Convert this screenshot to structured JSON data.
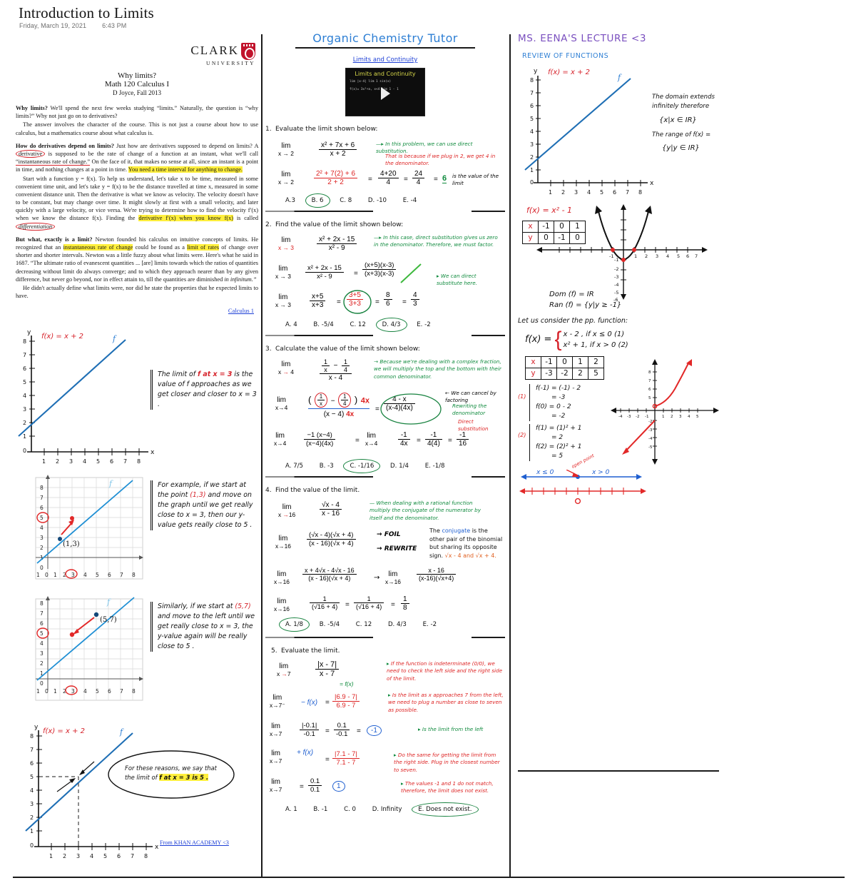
{
  "header": {
    "title": "Introduction to Limits",
    "date": "Friday, March 19, 2021",
    "time": "6:43 PM"
  },
  "left_column": {
    "logo": {
      "word": "CLARK",
      "sub": "UNIVERSITY"
    },
    "paper": {
      "title": "Why limits?",
      "course": "Math 120 Calculus I",
      "author": "D Joyce, Fall 2013",
      "p1_head": "Why limits?",
      "p1": "We'll spend the next few weeks studying “limits.” Naturally, the question is “why limits?” Why not just go on to derivatives?",
      "p2": "The answer involves the character of the course. This is not just a course about how to use calculus, but a mathematics course about what calculus is.",
      "p3_head": "How do derivatives depend on limits?",
      "p3_a": "Just how are derivatives supposed to depend on limits? A",
      "p3_circ": "derivative",
      "p3_b": "is supposed to be the rate of change of a function at an instant, what we'll call",
      "p3_und": "“instantaneous rate of change.”",
      "p3_c": "On the face of it, that makes no sense at all, since an instant is a point in time, and nothing changes at a point in time.",
      "p3_hl": "You need a time interval for anything to change.",
      "p4_a": "Start with a function y = f(x). To help us understand, let's take x to be time, measured in some convenient time unit, and let's take y = f(x) to be the distance travelled at time x, measured in some convenient distance unit. Then the derivative is what we know as velocity. The velocity doesn't have to be constant, but may change over time. It might slowly at first with a small velocity, and later quickly with a large velocity, or vice versa. We're trying to determine how to find the velocity f′(x) when we know the distance f(x). Finding the",
      "p4_hl": "derivative f′(x) when you know f(x)",
      "p4_b": "is called",
      "p4_circ": "differentiation",
      "p5_head": "But what, exactly is a limit?",
      "p5_a": "Newton founded his calculus on intuitive concepts of limits. He recognized that an",
      "p5_hl1": "instantaneous rate of change",
      "p5_b": "could be found as a",
      "p5_hl2": "limit of rates",
      "p5_c": "of change over shorter and shorter intervals. Newton was a little fuzzy about what limits were. Here's what he said in 1687. “The ultimate ratio of evanescent quantities ... [are] limits towards which the ratios of quantities decreasing without limit do always converge; and to which they approach nearer than by any given difference, but never go beyond, nor in effect attain to, till the quantities are diminished",
      "p5_it": "in infinitum.”",
      "p6": "He didn't actually define what limits were, nor did he state the properties that he expected limits to have.",
      "calculus_link": "Calculus 1"
    },
    "graph1": {
      "equation": "f(x) = x + 2",
      "f_label": "f",
      "y_axis": "y",
      "x_axis": "x",
      "y_ticks": [
        "8",
        "7",
        "6",
        "5",
        "4",
        "3",
        "2",
        "1",
        "0"
      ],
      "x_ticks": [
        "1",
        "2",
        "3",
        "4",
        "5",
        "6",
        "7",
        "8"
      ],
      "note": "The limit of f at x = 3 is the value of f approaches as we get closer and closer to x = 3 .",
      "note_red": "f at x = 3"
    },
    "graph2": {
      "f_label": "f",
      "point_label": "(1,3)",
      "circled_y": "5",
      "circled_x": "3",
      "y_ticks": [
        "8",
        "7",
        "6",
        "5",
        "4",
        "3",
        "2",
        "1",
        "0"
      ],
      "x_ticks": [
        "0",
        "1",
        "2",
        "3",
        "4",
        "5",
        "6",
        "7",
        "8"
      ],
      "note": "For example, if we start at the point (1,3) and move on the graph until we get really close to x = 3, then our y-value gets really close to 5 .",
      "note_red": "(1,3)"
    },
    "graph3": {
      "f_label": "f",
      "point_label": "(5,7)",
      "circled_y": "5",
      "circled_x": "3",
      "y_ticks": [
        "8",
        "7",
        "6",
        "5",
        "4",
        "3",
        "2",
        "1",
        "0"
      ],
      "x_ticks": [
        "0",
        "1",
        "2",
        "3",
        "4",
        "5",
        "6",
        "7",
        "8"
      ],
      "note": "Similarly, if we start at (5,7) and move to the left until we get really close to x = 3, the y-value again will be really close to 5 .",
      "note_red": "(5,7)"
    },
    "graph4": {
      "equation": "f(x) = x + 2",
      "f_label": "f",
      "y_axis": "y",
      "x_axis": "x",
      "y_ticks": [
        "8",
        "7",
        "6",
        "5",
        "4",
        "3",
        "2",
        "1",
        "0"
      ],
      "x_ticks": [
        "1",
        "2",
        "3",
        "4",
        "5",
        "6",
        "7",
        "8"
      ],
      "note_a": "For these reasons, we say that the limit of",
      "note_hl": "f at x = 3 is 5 .",
      "khan_link": "From KHAN ACADEMY <3"
    }
  },
  "middle_column": {
    "title": "Organic Chemistry Tutor",
    "subtitle_link": "Limits and Continuity",
    "video": {
      "title": "Limits and Continuity",
      "line1": "lim   |x-4|        lim    1 sin(x)",
      "line2": "x→4   x-4        x→0   x",
      "line3": "f(x)= 3x²+a,   x<4     lim   1 - 1",
      "line4": "      (x²+5x+3  x≥4    x→4  x   4"
    },
    "questions": [
      {
        "number": "1.",
        "prompt": "Evaluate the limit shown below:",
        "limit_lim": "lim",
        "limit_sub": "x → 2",
        "num": "x² + 7x + 6",
        "den": "x + 2",
        "note1": "In this problem, we can use direct substitution.",
        "note2": "That is because if we plug in 2, we get 4 in the denominator.",
        "step_num": "2² + 7(2) + 6",
        "step_den": "2 + 2",
        "step_eq1_top": "4+20",
        "step_eq1_bot": "4",
        "step_eq2_top": "24",
        "step_eq2_bot": "4",
        "result": "6",
        "result_note": "is the value of the limit",
        "choices": [
          "A.3",
          "B. 6",
          "C. 8",
          "D. -10",
          "E. -4"
        ],
        "selected": 1
      },
      {
        "number": "2.",
        "prompt": "Find the value of the limit shown below:",
        "limit_lim": "lim",
        "limit_sub": "x → 3",
        "num": "x² + 2x - 15",
        "den": "x² - 9",
        "note1": "In this case, direct substitution gives us zero in the denominator. Therefore, we must factor.",
        "factored_num": "(x+5)(x-3)",
        "factored_den": "(x+3)(x-3)",
        "note2": "We can direct substitute here.",
        "simp_num": "x+5",
        "simp_den": "x+3",
        "sub_num": "3+5",
        "sub_den": "3+3",
        "val_top": "8",
        "val_bot": "6",
        "final_top": "4",
        "final_bot": "3",
        "choices": [
          "A.  4",
          "B. -5/4",
          "C. 12",
          "D. 4/3",
          "E. -2"
        ],
        "selected": 3
      },
      {
        "number": "3.",
        "prompt": "Calculate the value of the limit shown below:",
        "limit_lim": "lim",
        "limit_sub": "x → 4",
        "num": "1/x  -  1/4",
        "den": "x - 4",
        "note1": "Because we're dealing with a complex fraction, we will multiply the top and the bottom with their common denominator.",
        "note2": "We can cancel by factoring",
        "note3": "Rewriting the denominator",
        "note4": "Direct substitution",
        "mid_num": "4 - x",
        "mid_den": "(x-4)(4x)",
        "res_a": "-1",
        "res_b": "4x",
        "res_c": "-1",
        "res_d": "4(4)",
        "res_e": "-1",
        "res_f": "16",
        "choices": [
          "A.  7/5",
          "B. -3",
          "C. -1/16",
          "D. 1/4",
          "E. -1/8"
        ],
        "selected": 2
      },
      {
        "number": "4.",
        "prompt": "Find the value of the limit.",
        "limit_lim": "lim",
        "limit_sub": "x → 16",
        "num": "√x - 4",
        "den": "x - 16",
        "note1": "When dealing with a rational function multiply the conjugate of the numerator by itself and the denominator.",
        "step2_num": "(√x - 4)(√x + 4)",
        "step2_den": "(x - 16)(√x + 4)",
        "label_foil": "FOIL",
        "label_rewrite": "REWRITE",
        "step3_num": "x + 4√x - 4√x - 16",
        "step3_den": "(x - 16)(√x + 4)",
        "step4_num": "x - 16",
        "step4_den": "(x-16)(√x+4)",
        "step5_a": "1",
        "step5_b": "(√16 + 4)",
        "step5_c": "1",
        "step5_d": "(√16 + 4)",
        "step5_res_top": "1",
        "step5_res_bot": "8",
        "conjugate_note_a": "The",
        "conjugate_word": "conjugate",
        "conjugate_note_b": "is the other pair of the binomial but sharing its opposite sign.",
        "conjugate_note_c": "√x - 4 and √x + 4.",
        "choices": [
          "A.  1/8",
          "B. -5/4",
          "C. 12",
          "D. 4/3",
          "E. -2"
        ],
        "selected": 0
      },
      {
        "number": "5.",
        "prompt": "Evaluate the limit.",
        "limit_lim": "lim",
        "limit_sub": "x → 7",
        "num": "|x - 7|",
        "den": "x - 7",
        "fx_label": "= f(x)",
        "note1": "If the function is indeterminate (0/0), we need to check the left side and the right side of the limit.",
        "note2": "Is the limit as x approaches 7 from the left, we need to plug a number as close to seven as possible.",
        "note3": "Is the limit from the left",
        "note4": "Do the same for getting the limit from the right side. Plug in the closest number to seven.",
        "note5": "The values -1 and 1 do not match, therefore, the limit does not exist.",
        "left_lim": "x→7⁻ f(x)",
        "left_num": "|6.9 - 7|",
        "left_den": "6.9 - 7",
        "left_step_num": "|-0.1|",
        "left_step_den": "-0.1",
        "left_val_num": "0.1",
        "left_val_den": "-0.1",
        "left_result": "-1",
        "right_lim": "x→7⁺ f(x)",
        "right_num": "|7.1 - 7|",
        "right_den": "7.1 - 7",
        "right_val_num": "0.1",
        "right_val_den": "0.1",
        "right_result": "1",
        "choices": [
          "A.  1",
          "B. -1",
          "C. 0",
          "D. Infinity",
          "E. Does not exist."
        ],
        "selected": 4
      }
    ]
  },
  "right_column": {
    "title": "MS. EENA'S LECTURE <3",
    "section": "REVIEW OF FUNCTIONS",
    "graph_linear": {
      "equation": "f(x) = x + 2",
      "f_label": "f",
      "y_axis": "y",
      "x_axis": "x",
      "y_ticks": [
        "8",
        "7",
        "6",
        "5",
        "4",
        "3",
        "2",
        "1",
        "0"
      ],
      "x_ticks": [
        "1",
        "2",
        "3",
        "4",
        "5",
        "6",
        "7",
        "8"
      ],
      "note1": "The domain extends infinitely therefore",
      "note2": "{x|x ∈ IR}",
      "note3": "The range of f(x) =",
      "note4": "{y|y ∈ IR}"
    },
    "parabola": {
      "equation": "f(x) = x² - 1",
      "table": {
        "row_x": [
          "x",
          "-1",
          "0",
          "1"
        ],
        "row_y": [
          "y",
          "0",
          "-1",
          "0"
        ]
      },
      "dom": "Dom (f) = IR",
      "ran": "Ran (f) = {y|y ≥ -1}",
      "x_labels": [
        "-1",
        "1",
        "2",
        "3",
        "4",
        "5",
        "6",
        "7"
      ],
      "y_labels": [
        "-1",
        "-2",
        "-3",
        "-4",
        "-5",
        "-6"
      ]
    },
    "piecewise": {
      "intro": "Let us consider the pp. function:",
      "fx": "f(x) =",
      "case1": "x - 2 , if x ≤ 0  (1)",
      "case2": "x² + 1, if x > 0  (2)",
      "table": {
        "row_x": [
          "x",
          "-1",
          "0",
          "1",
          "2"
        ],
        "row_y": [
          "y",
          "-3",
          "-2",
          "2",
          "5"
        ]
      },
      "calc1_label": "(1)",
      "calc1_a": "f(-1) = (-1) - 2",
      "calc1_b": "= -3",
      "calc1_c": "f(0) = 0 - 2",
      "calc1_d": "= -2",
      "calc2_label": "(2)",
      "calc2_a": "f(1) = (1)² + 1",
      "calc2_b": "= 2",
      "calc2_c": "f(2) = (2)² + 1",
      "calc2_d": "= 5",
      "interval_left": "x ≤ 0",
      "interval_right": "x > 0",
      "open_note": "open point"
    }
  }
}
